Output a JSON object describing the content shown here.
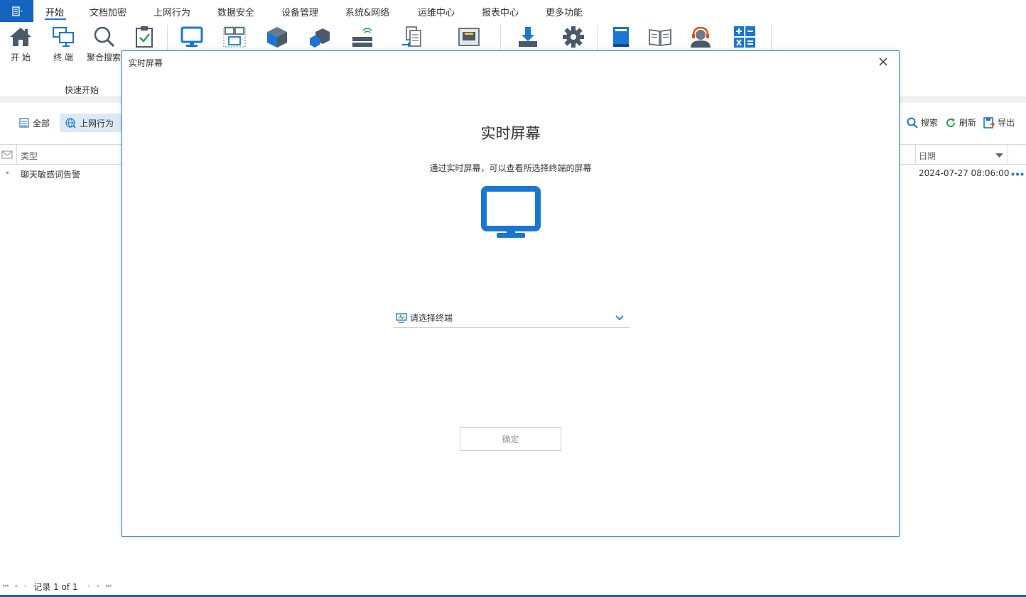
{
  "menu": {
    "items": [
      "开始",
      "文档加密",
      "上网行为",
      "数据安全",
      "设备管理",
      "系统&网络",
      "运维中心",
      "报表中心",
      "更多功能"
    ]
  },
  "ribbon": {
    "tools": [
      {
        "label": "开 始",
        "icon": "home-icon"
      },
      {
        "label": "终 端",
        "icon": "terminals-icon"
      },
      {
        "label": "聚合搜索",
        "icon": "search-icon"
      },
      {
        "label": "",
        "icon": "clipboard-check-icon"
      },
      {
        "label": "",
        "icon": "monitor-icon"
      },
      {
        "label": "",
        "icon": "network-monitor-icon"
      },
      {
        "label": "",
        "icon": "cube-icon"
      },
      {
        "label": "",
        "icon": "cubes-icon"
      },
      {
        "label": "",
        "icon": "wireless-device-icon"
      },
      {
        "label": "",
        "icon": "document-transfer-icon"
      },
      {
        "label": "",
        "icon": "network-port-icon"
      },
      {
        "label": "",
        "icon": "download-tray-icon"
      },
      {
        "label": "",
        "icon": "gear-icon"
      },
      {
        "label": "",
        "icon": "book-icon"
      },
      {
        "label": "",
        "icon": "open-book-icon"
      },
      {
        "label": "",
        "icon": "support-agent-icon"
      },
      {
        "label": "",
        "icon": "calculator-icon"
      }
    ],
    "group_label": "快速开始"
  },
  "filters": {
    "all": "全部",
    "web": "上网行为"
  },
  "actions": {
    "search": "搜索",
    "refresh": "刷新",
    "export": "导出"
  },
  "table": {
    "col_type": "类型",
    "col_date": "日期",
    "rows": [
      {
        "type": "聊天敏感词告警",
        "date": "2024-07-27 08:06:00"
      }
    ]
  },
  "pager": {
    "text": "记录 1 of 1"
  },
  "modal": {
    "title": "实时屏幕",
    "heading": "实时屏幕",
    "description": "通过实时屏幕，可以查看所选择终端的屏幕",
    "select_placeholder": "请选择终端",
    "ok_label": "确定"
  },
  "colors": {
    "accent": "#1976d2",
    "brand": "#1565c0",
    "icon_gray": "#4a5a6a"
  }
}
